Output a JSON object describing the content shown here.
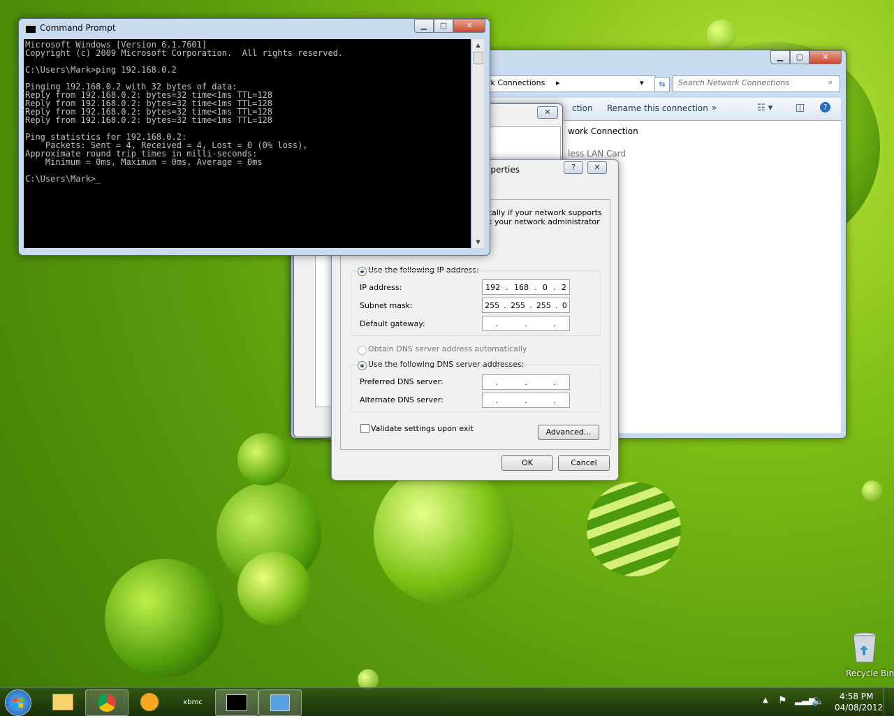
{
  "cmd": {
    "title": "Command Prompt",
    "lines": "Microsoft Windows [Version 6.1.7601]\nCopyright (c) 2009 Microsoft Corporation.  All rights reserved.\n\nC:\\Users\\Mark>ping 192.168.0.2\n\nPinging 192.168.0.2 with 32 bytes of data:\nReply from 192.168.0.2: bytes=32 time<1ms TTL=128\nReply from 192.168.0.2: bytes=32 time<1ms TTL=128\nReply from 192.168.0.2: bytes=32 time<1ms TTL=128\nReply from 192.168.0.2: bytes=32 time<1ms TTL=128\n\nPing statistics for 192.168.0.2:\n    Packets: Sent = 4, Received = 4, Lost = 0 (0% loss),\nApproximate round trip times in milli-seconds:\n    Minimum = 0ms, Maximum = 0ms, Average = 0ms\n\nC:\\Users\\Mark>_"
  },
  "net": {
    "breadcrumb": "rk Connections",
    "search_placeholder": "Search Network Connections",
    "cmd_partial": "ction",
    "rename": "Rename this connection",
    "more": "»",
    "item_name": "work Connection",
    "item_sub": "less LAN Card"
  },
  "ipv4": {
    "title_partial": "operties",
    "help": "?",
    "desc1": "cally if your network supports",
    "desc2": "k your network administrator",
    "use_ip": "Use the following IP address:",
    "ip_label": "IP address:",
    "ip_value": [
      "192",
      "168",
      "0",
      "2"
    ],
    "mask_label": "Subnet mask:",
    "mask_value": [
      "255",
      "255",
      "255",
      "0"
    ],
    "gw_label": "Default gateway:",
    "dns_auto": "Obtain DNS server address automatically",
    "dns_use": "Use the following DNS server addresses:",
    "pref_dns": "Preferred DNS server:",
    "alt_dns": "Alternate DNS server:",
    "validate": "Validate settings upon exit",
    "advanced": "Advanced...",
    "ok": "OK",
    "cancel": "Cancel"
  },
  "desktop": {
    "recycle_bin": "Recycle Bin"
  },
  "tray": {
    "time": "4:58 PM",
    "date": "04/08/2012"
  }
}
